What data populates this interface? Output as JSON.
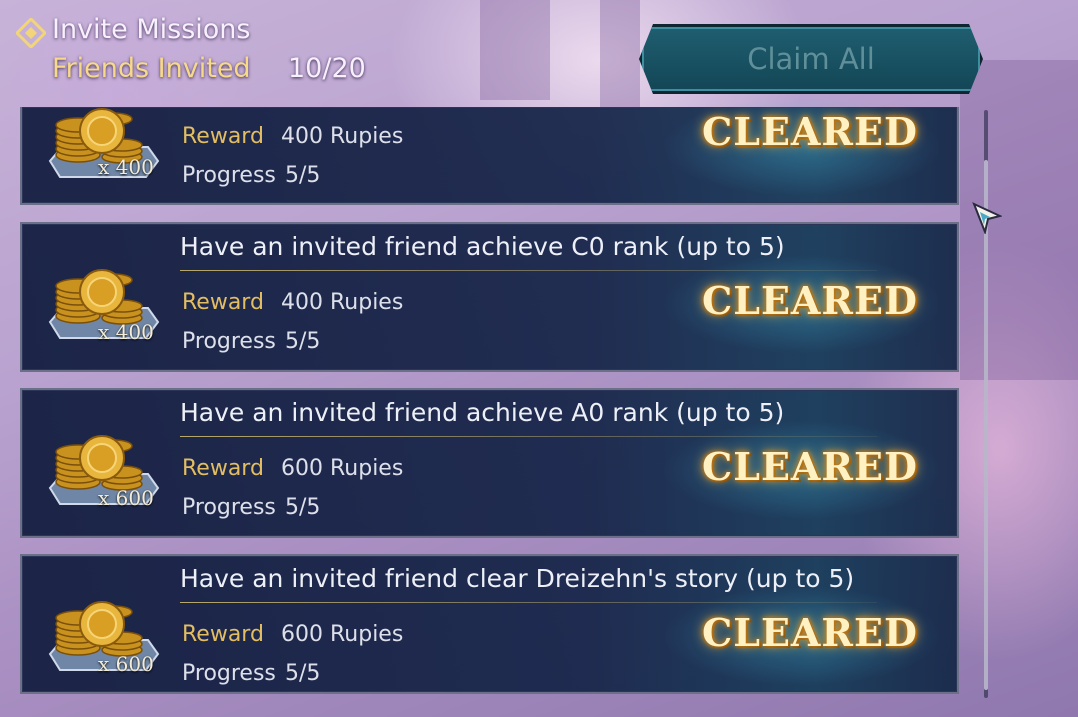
{
  "header": {
    "title": "Invite Missions",
    "friends_label": "Friends Invited",
    "friends_count": "10/20"
  },
  "claim_all_label": "Claim All",
  "missions": [
    {
      "title": "",
      "reward_label": "Reward",
      "reward_value": "400 Rupies",
      "progress_label": "Progress",
      "progress_value": "5/5",
      "qty": "x 400",
      "status": "CLEARED"
    },
    {
      "title": "Have an invited friend achieve C0 rank",
      "title_suffix": " (up to 5)",
      "reward_label": "Reward",
      "reward_value": "400 Rupies",
      "progress_label": "Progress",
      "progress_value": "5/5",
      "qty": "x 400",
      "status": "CLEARED"
    },
    {
      "title": "Have an invited friend achieve A0 rank",
      "title_suffix": " (up to 5)",
      "reward_label": "Reward",
      "reward_value": "600 Rupies",
      "progress_label": "Progress",
      "progress_value": "5/5",
      "qty": "x 600",
      "status": "CLEARED"
    },
    {
      "title": "Have an invited friend clear Dreizehn's story",
      "title_suffix": " (up to 5)",
      "reward_label": "Reward",
      "reward_value": "600 Rupies",
      "progress_label": "Progress",
      "progress_value": "5/5",
      "qty": "x 600",
      "status": "CLEARED"
    }
  ],
  "colors": {
    "accent_gold": "#e2bd62",
    "panel": "#16203f",
    "claim_button": "#1f5e70"
  },
  "icons": {
    "header": "diamond-icon",
    "reward": "coin-stack-icon",
    "cursor": "pointer-cursor-icon"
  }
}
